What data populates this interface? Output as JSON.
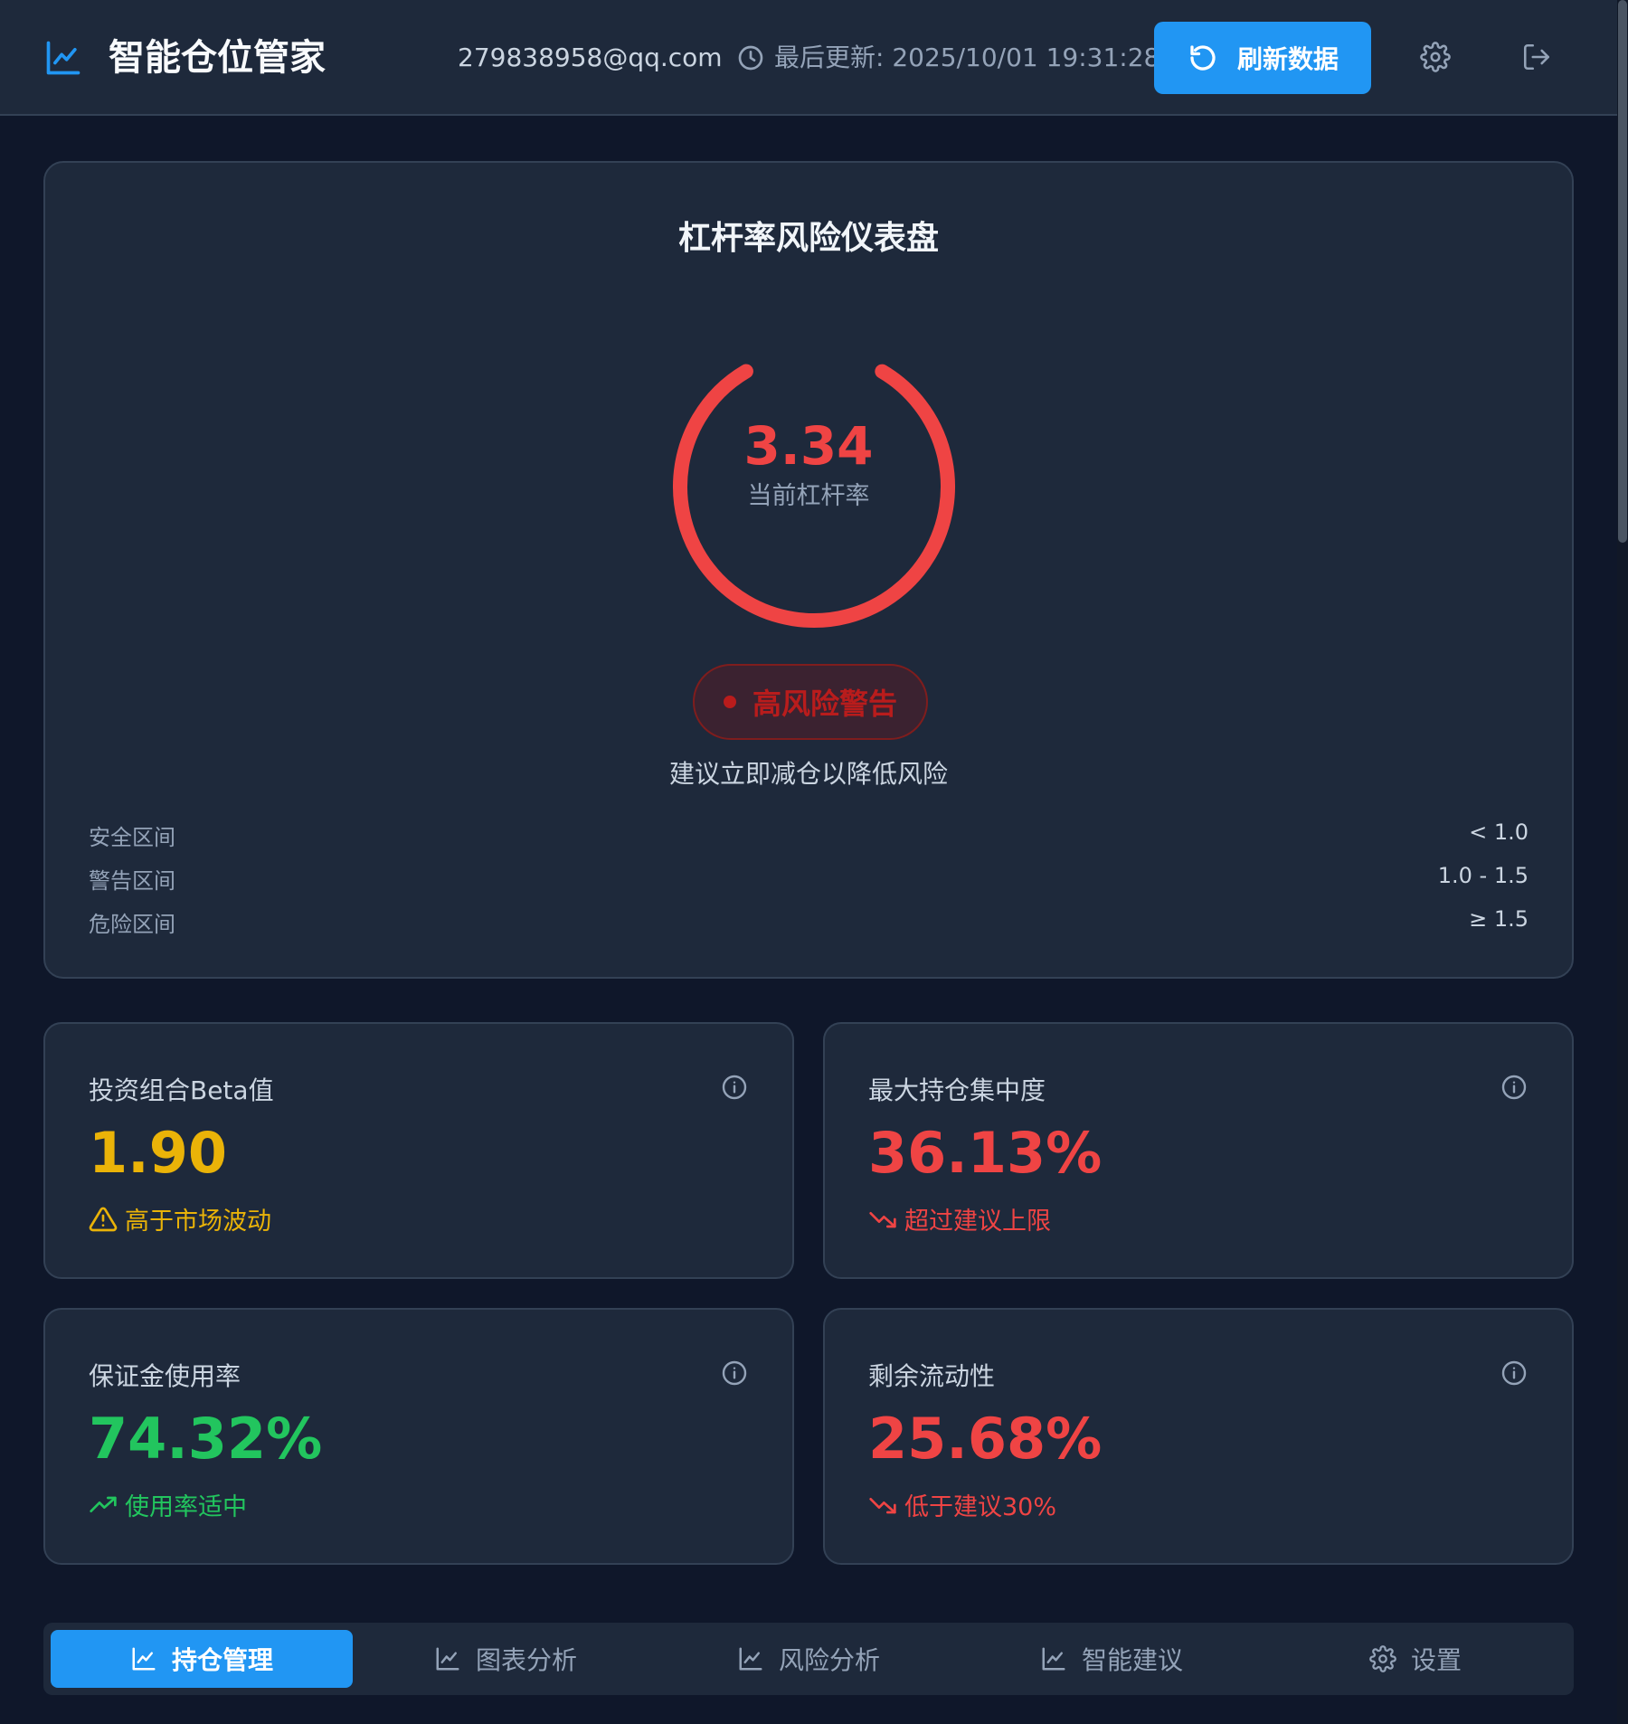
{
  "colors": {
    "accent": "#2196f3",
    "danger": "#ef4444",
    "warning": "#eab308",
    "success": "#22c55e",
    "card_bg": "#1e293b",
    "page_bg": "#0f172a"
  },
  "header": {
    "app_title": "智能仓位管家",
    "brand_icon": "line-chart-icon",
    "user_email": "279838958@qq.com",
    "last_update": "最后更新: 2025/10/01 19:31:28",
    "refresh_label": "刷新数据",
    "refresh_icon": "refresh-icon",
    "settings_icon": "gear-icon",
    "logout_icon": "logout-icon"
  },
  "gauge": {
    "title": "杠杆率风险仪表盘",
    "value": "3.34",
    "value_label": "当前杠杆率",
    "fill_fraction": 0.83,
    "badge_text": "高风险警告",
    "advice": "建议立即减仓以降低风险",
    "zones": [
      {
        "name": "安全区间",
        "range": "< 1.0"
      },
      {
        "name": "警告区间",
        "range": "1.0 - 1.5"
      },
      {
        "name": "危险区间",
        "range": "≥ 1.5"
      }
    ]
  },
  "metrics": [
    {
      "title": "投资组合Beta值",
      "value": "1.90",
      "note": "高于市场波动",
      "color": "#eab308",
      "note_icon": "warning-triangle-icon"
    },
    {
      "title": "最大持仓集中度",
      "value": "36.13%",
      "note": "超过建议上限",
      "color": "#ef4444",
      "note_icon": "trending-down-icon"
    },
    {
      "title": "保证金使用率",
      "value": "74.32%",
      "note": "使用率适中",
      "color": "#22c55e",
      "note_icon": "trending-up-icon"
    },
    {
      "title": "剩余流动性",
      "value": "25.68%",
      "note": "低于建议30%",
      "color": "#ef4444",
      "note_icon": "trending-down-icon"
    }
  ],
  "nav": {
    "active_index": 0,
    "tabs": [
      {
        "label": "持仓管理",
        "icon": "line-chart-icon"
      },
      {
        "label": "图表分析",
        "icon": "line-chart-icon"
      },
      {
        "label": "风险分析",
        "icon": "line-chart-icon"
      },
      {
        "label": "智能建议",
        "icon": "line-chart-icon"
      },
      {
        "label": "设置",
        "icon": "gear-icon"
      }
    ]
  }
}
